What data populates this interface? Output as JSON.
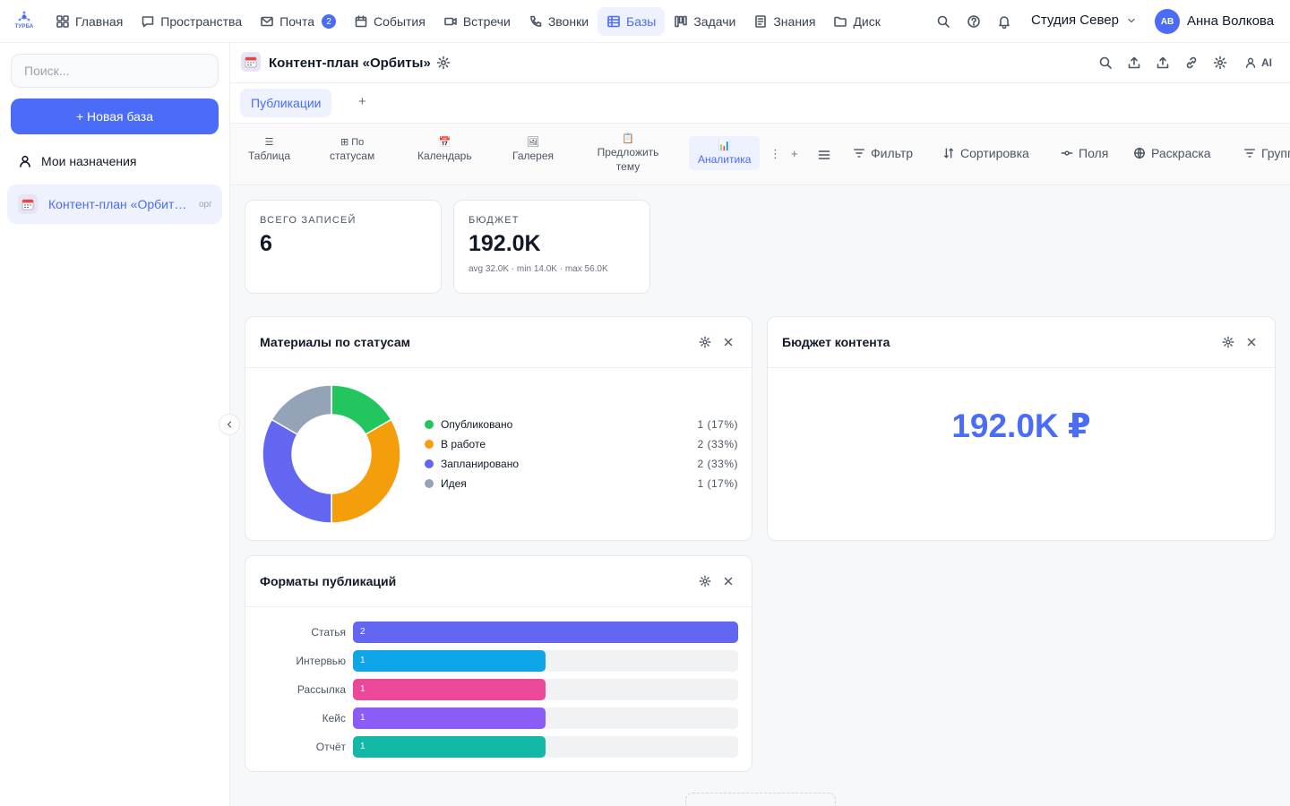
{
  "app": {
    "logo_text": "ТУРБА"
  },
  "nav": {
    "items": [
      {
        "label": "Главная",
        "icon": "grid-icon",
        "active": false
      },
      {
        "label": "Пространства",
        "icon": "chat-icon",
        "active": false
      },
      {
        "label": "Почта",
        "icon": "mail-icon",
        "active": false,
        "badge": "2"
      },
      {
        "label": "События",
        "icon": "calendar-icon",
        "active": false
      },
      {
        "label": "Встречи",
        "icon": "video-icon",
        "active": false
      },
      {
        "label": "Звонки",
        "icon": "phone-icon",
        "active": false
      },
      {
        "label": "Базы",
        "icon": "table-icon",
        "active": true
      },
      {
        "label": "Задачи",
        "icon": "kanban-icon",
        "active": false
      },
      {
        "label": "Знания",
        "icon": "book-icon",
        "active": false
      },
      {
        "label": "Диск",
        "icon": "folder-icon",
        "active": false
      }
    ],
    "workspace": "Студия Север",
    "user_initials": "АВ",
    "user_name": "Анна Волкова"
  },
  "sidebar": {
    "search_placeholder": "Поиск...",
    "new_base": "+ Новая база",
    "my_assignments": "Мои назначения",
    "base_item": "Контент-план «Орбиты»",
    "base_item_extra": "орг"
  },
  "header": {
    "title": "Контент-план «Орбиты»",
    "ai_label": "AI"
  },
  "tabs": {
    "items": [
      "Публикации"
    ],
    "add": "+"
  },
  "toolbar": {
    "views": [
      {
        "glyph": "☰",
        "label": "Таблица"
      },
      {
        "glyph": "⊞ По",
        "label": "статусам"
      },
      {
        "glyph": "📅",
        "label": "Календарь"
      },
      {
        "glyph": "🖼",
        "label": "Галерея"
      },
      {
        "glyph": "📋",
        "label": "Предложить тему"
      },
      {
        "glyph": "📊",
        "label": "Аналитика"
      }
    ],
    "more": "⋮",
    "add": "+",
    "filter": "Фильтр",
    "sort": "Сортировка",
    "fields": "Поля",
    "coloring": "Раскраска",
    "group": "Группировка"
  },
  "stats": {
    "total_label": "ВСЕГО ЗАПИСЕЙ",
    "total_value": "6",
    "budget_label": "БЮДЖЕТ",
    "budget_value": "192.0K",
    "budget_sub": "avg 32.0K · min 14.0K · max 56.0K"
  },
  "status_card": {
    "title": "Материалы по статусам",
    "chart_data": {
      "type": "pie",
      "variant": "donut",
      "slices": [
        {
          "label": "Опубликовано",
          "value": 1,
          "display": "1 (17%)",
          "color": "#22c55e"
        },
        {
          "label": "В работе",
          "value": 2,
          "display": "2 (33%)",
          "color": "#f59e0b"
        },
        {
          "label": "Запланировано",
          "value": 2,
          "display": "2 (33%)",
          "color": "#6366f1"
        },
        {
          "label": "Идея",
          "value": 1,
          "display": "1 (17%)",
          "color": "#94a3b8"
        }
      ]
    }
  },
  "budget_card": {
    "title": "Бюджет контента",
    "value": "192.0K ₽"
  },
  "formats_card": {
    "title": "Форматы публикаций",
    "chart_data": {
      "type": "bar",
      "orientation": "horizontal",
      "categories": [
        "Статья",
        "Интервью",
        "Рассылка",
        "Кейс",
        "Отчёт"
      ],
      "values": [
        2,
        1,
        1,
        1,
        1
      ],
      "colors": [
        "#6366f1",
        "#0ea5e9",
        "#ec4899",
        "#8b5cf6",
        "#14b8a6"
      ],
      "xlim": [
        0,
        2
      ]
    }
  },
  "colors": {
    "accent": "#4a6cf7",
    "active_bg": "#eef2ff"
  }
}
